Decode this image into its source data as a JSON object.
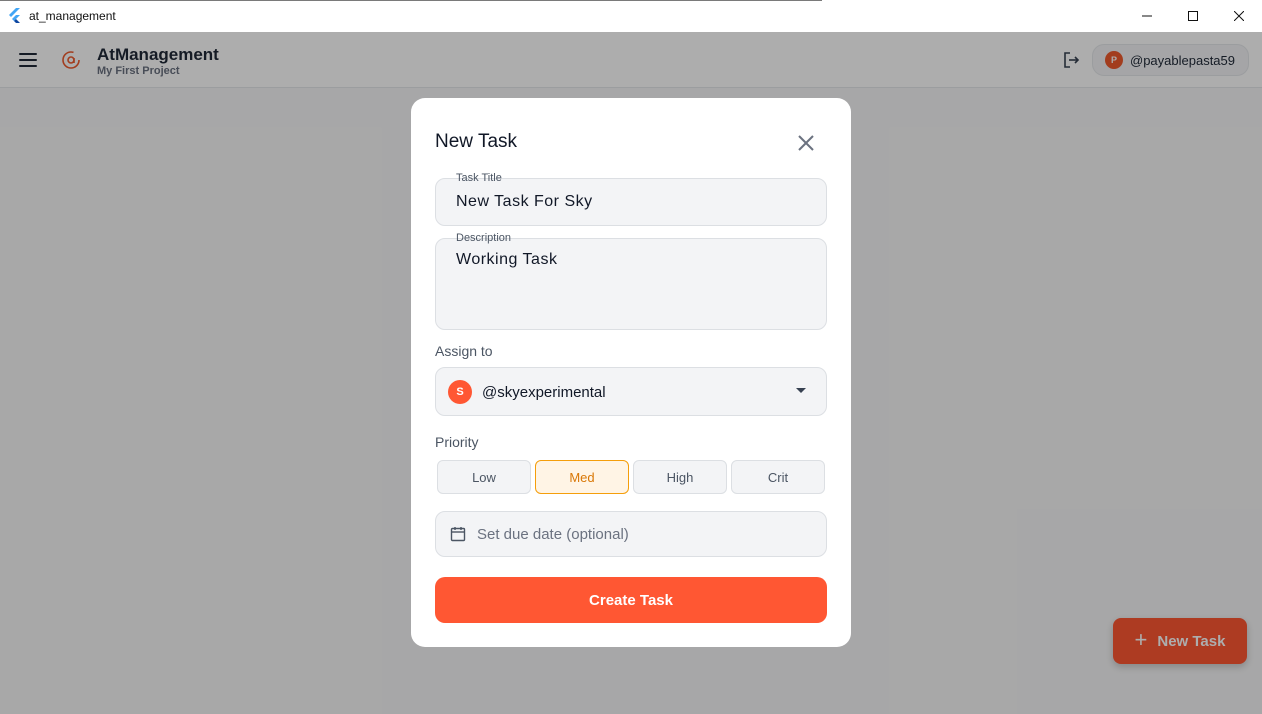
{
  "window": {
    "title": "at_management",
    "controls": [
      "minimize-icon",
      "maximize-icon",
      "close-icon"
    ]
  },
  "appbar": {
    "brand_title": "AtManagement",
    "brand_subtitle": "My First Project",
    "user": {
      "initial": "P",
      "handle": "@payablepasta59"
    }
  },
  "fab": {
    "label": "New Task",
    "icon": "plus-icon"
  },
  "dialog": {
    "title": "New Task",
    "task_title": {
      "label": "Task Title",
      "value": "New Task For Sky"
    },
    "description": {
      "label": "Description",
      "value": "Working Task"
    },
    "assign": {
      "label": "Assign to",
      "initial": "S",
      "handle": "@skyexperimental"
    },
    "priority": {
      "label": "Priority",
      "options": [
        "Low",
        "Med",
        "High",
        "Crit"
      ],
      "selected": "Med"
    },
    "due_date": {
      "placeholder": "Set due date (optional)",
      "icon": "calendar-icon"
    },
    "submit_label": "Create Task"
  },
  "colors": {
    "accent": "#ff5733",
    "priority_active": "#f59e0b",
    "scrim": "rgba(0,0,0,0.32)"
  }
}
